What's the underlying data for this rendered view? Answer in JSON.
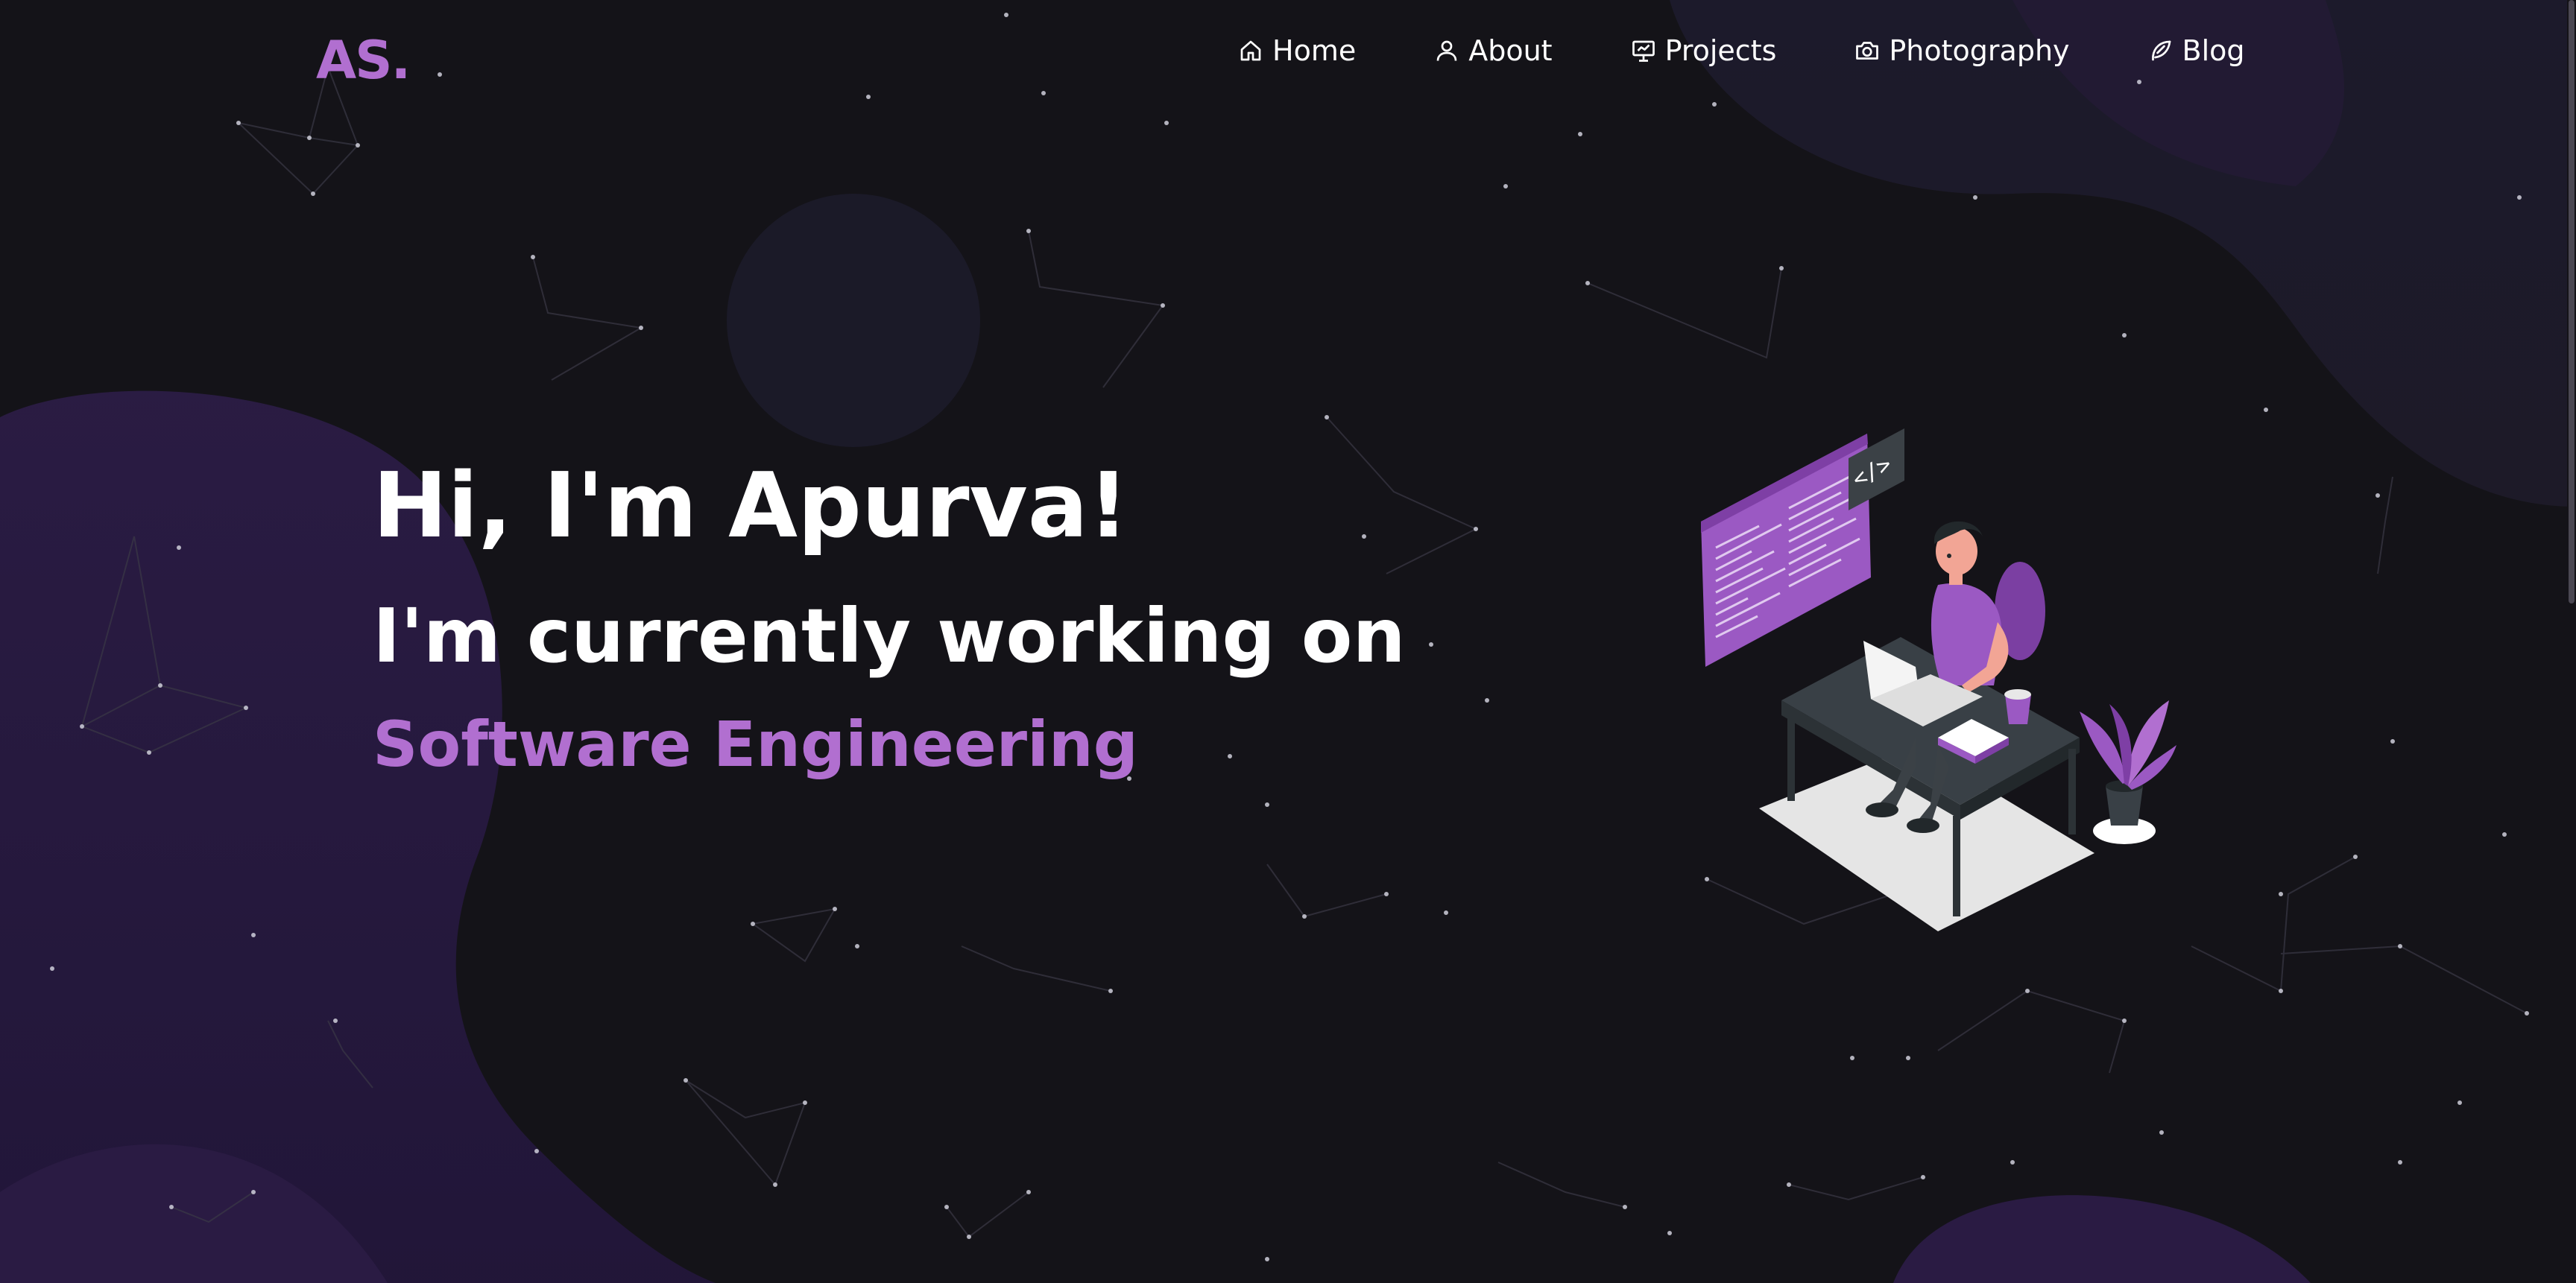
{
  "header": {
    "logo": "AS.",
    "nav": [
      {
        "label": "Home",
        "icon": "home-icon"
      },
      {
        "label": "About",
        "icon": "user-icon"
      },
      {
        "label": "Projects",
        "icon": "presentation-icon"
      },
      {
        "label": "Photography",
        "icon": "camera-icon"
      },
      {
        "label": "Blog",
        "icon": "feather-icon"
      }
    ]
  },
  "hero": {
    "greeting": "Hi, I'm Apurva!",
    "subtitle": "I'm currently working on",
    "highlight": "Software Engineering"
  },
  "illustration": {
    "monitor_tag": "</>",
    "description_icon": "developer-at-desk-illustration"
  },
  "colors": {
    "background": "#141318",
    "accent": "#b16fd0",
    "text": "#ffffff",
    "blob": "#2a1a40"
  }
}
